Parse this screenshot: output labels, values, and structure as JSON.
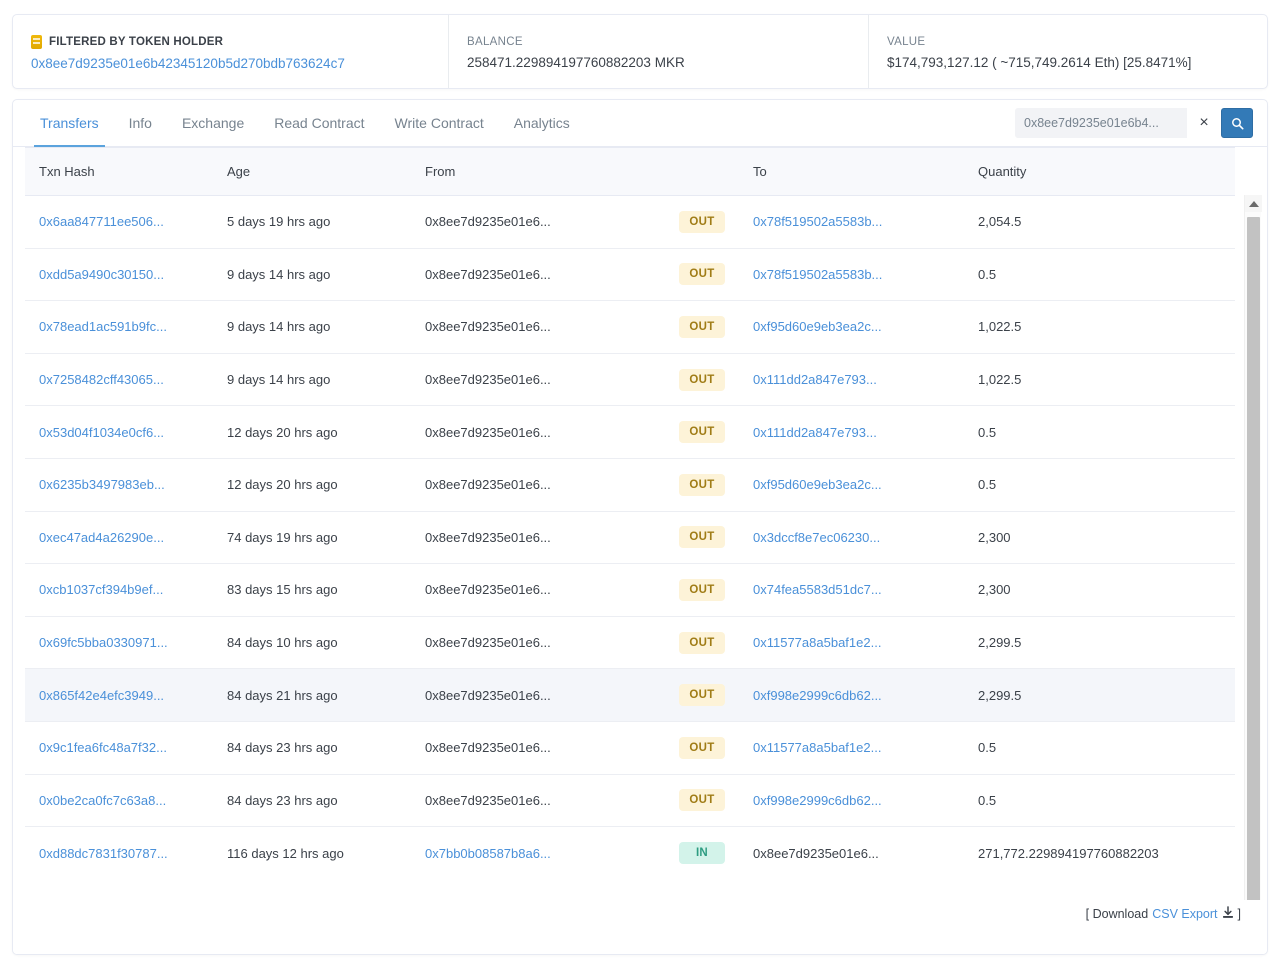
{
  "summary": {
    "filter": {
      "icon": "token-icon",
      "label": "FILTERED BY TOKEN HOLDER",
      "address": "0x8ee7d9235e01e6b42345120b5d270bdb763624c7"
    },
    "balance": {
      "label": "BALANCE",
      "value": "258471.229894197760882203 MKR"
    },
    "value": {
      "label": "VALUE",
      "value": "$174,793,127.12 ( ~715,749.2614 Eth) [25.8471%]"
    }
  },
  "tabs": [
    {
      "label": "Transfers",
      "active": true
    },
    {
      "label": "Info",
      "active": false
    },
    {
      "label": "Exchange",
      "active": false
    },
    {
      "label": "Read Contract",
      "active": false
    },
    {
      "label": "Write Contract",
      "active": false
    },
    {
      "label": "Analytics",
      "active": false
    }
  ],
  "search": {
    "value": "0x8ee7d9235e01e6b4...",
    "placeholder": "Search",
    "clear_label": "×",
    "button_icon": "search-icon"
  },
  "table": {
    "columns": [
      "Txn Hash",
      "Age",
      "From",
      "",
      "To",
      "Quantity"
    ],
    "rows": [
      {
        "hash": "0x6aa847711ee506...",
        "age": "5 days 19 hrs ago",
        "from": "0x8ee7d9235e01e6...",
        "from_link": false,
        "dir": "OUT",
        "to": "0x78f519502a5583b...",
        "to_link": true,
        "qty": "2,054.5",
        "highlight": false
      },
      {
        "hash": "0xdd5a9490c30150...",
        "age": "9 days 14 hrs ago",
        "from": "0x8ee7d9235e01e6...",
        "from_link": false,
        "dir": "OUT",
        "to": "0x78f519502a5583b...",
        "to_link": true,
        "qty": "0.5",
        "highlight": false
      },
      {
        "hash": "0x78ead1ac591b9fc...",
        "age": "9 days 14 hrs ago",
        "from": "0x8ee7d9235e01e6...",
        "from_link": false,
        "dir": "OUT",
        "to": "0xf95d60e9eb3ea2c...",
        "to_link": true,
        "qty": "1,022.5",
        "highlight": false
      },
      {
        "hash": "0x7258482cff43065...",
        "age": "9 days 14 hrs ago",
        "from": "0x8ee7d9235e01e6...",
        "from_link": false,
        "dir": "OUT",
        "to": "0x111dd2a847e793...",
        "to_link": true,
        "qty": "1,022.5",
        "highlight": false
      },
      {
        "hash": "0x53d04f1034e0cf6...",
        "age": "12 days 20 hrs ago",
        "from": "0x8ee7d9235e01e6...",
        "from_link": false,
        "dir": "OUT",
        "to": "0x111dd2a847e793...",
        "to_link": true,
        "qty": "0.5",
        "highlight": false
      },
      {
        "hash": "0x6235b3497983eb...",
        "age": "12 days 20 hrs ago",
        "from": "0x8ee7d9235e01e6...",
        "from_link": false,
        "dir": "OUT",
        "to": "0xf95d60e9eb3ea2c...",
        "to_link": true,
        "qty": "0.5",
        "highlight": false
      },
      {
        "hash": "0xec47ad4a26290e...",
        "age": "74 days 19 hrs ago",
        "from": "0x8ee7d9235e01e6...",
        "from_link": false,
        "dir": "OUT",
        "to": "0x3dccf8e7ec06230...",
        "to_link": true,
        "qty": "2,300",
        "highlight": false
      },
      {
        "hash": "0xcb1037cf394b9ef...",
        "age": "83 days 15 hrs ago",
        "from": "0x8ee7d9235e01e6...",
        "from_link": false,
        "dir": "OUT",
        "to": "0x74fea5583d51dc7...",
        "to_link": true,
        "qty": "2,300",
        "highlight": false
      },
      {
        "hash": "0x69fc5bba0330971...",
        "age": "84 days 10 hrs ago",
        "from": "0x8ee7d9235e01e6...",
        "from_link": false,
        "dir": "OUT",
        "to": "0x11577a8a5baf1e2...",
        "to_link": true,
        "qty": "2,299.5",
        "highlight": false
      },
      {
        "hash": "0x865f42e4efc3949...",
        "age": "84 days 21 hrs ago",
        "from": "0x8ee7d9235e01e6...",
        "from_link": false,
        "dir": "OUT",
        "to": "0xf998e2999c6db62...",
        "to_link": true,
        "qty": "2,299.5",
        "highlight": true
      },
      {
        "hash": "0x9c1fea6fc48a7f32...",
        "age": "84 days 23 hrs ago",
        "from": "0x8ee7d9235e01e6...",
        "from_link": false,
        "dir": "OUT",
        "to": "0x11577a8a5baf1e2...",
        "to_link": true,
        "qty": "0.5",
        "highlight": false
      },
      {
        "hash": "0x0be2ca0fc7c63a8...",
        "age": "84 days 23 hrs ago",
        "from": "0x8ee7d9235e01e6...",
        "from_link": false,
        "dir": "OUT",
        "to": "0xf998e2999c6db62...",
        "to_link": true,
        "qty": "0.5",
        "highlight": false
      },
      {
        "hash": "0xd88dc7831f30787...",
        "age": "116 days 12 hrs ago",
        "from": "0x7bb0b08587b8a6...",
        "from_link": true,
        "dir": "IN",
        "to": "0x8ee7d9235e01e6...",
        "to_link": false,
        "qty": "271,772.229894197760882203",
        "highlight": false
      }
    ]
  },
  "footer": {
    "prefix": "[ Download",
    "link": "CSV Export",
    "suffix": "]",
    "icon": "download-icon"
  },
  "scrollbar": {
    "up_icon": "caret-up-icon",
    "down_icon": "caret-down-icon"
  },
  "colors": {
    "link": "#4a90d9",
    "out_bg": "#fdf3d8",
    "out_fg": "#a07c16",
    "in_bg": "#d3f3ea",
    "in_fg": "#2e9c82",
    "accent": "#337ab7",
    "token": "#f0b90b"
  }
}
